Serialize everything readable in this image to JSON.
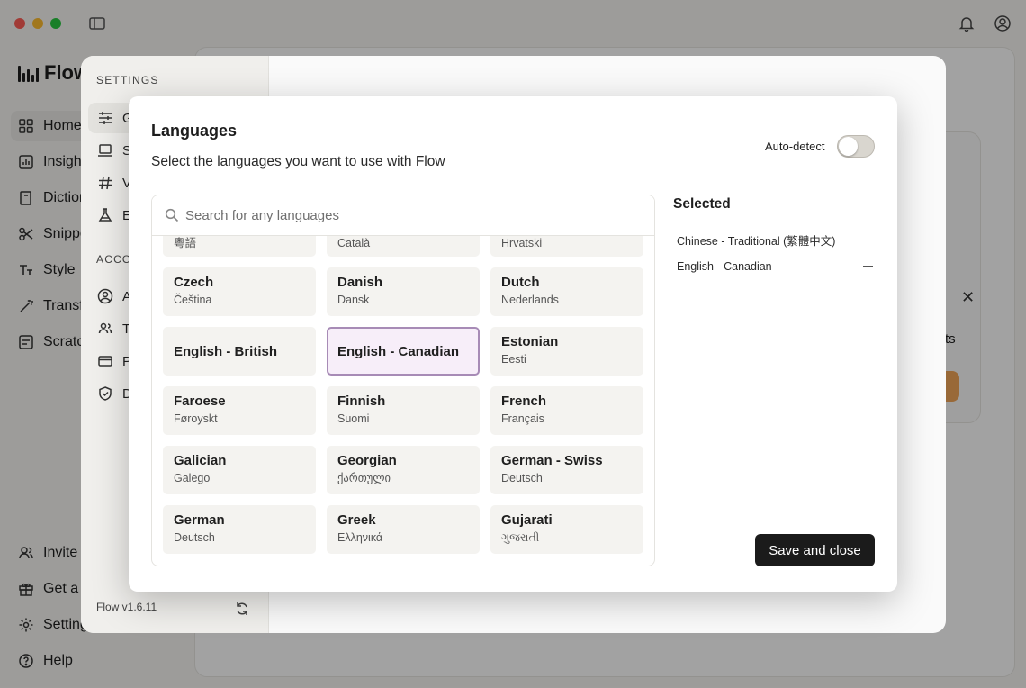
{
  "app": {
    "brand": "Flow"
  },
  "main_nav": [
    {
      "label": "Home",
      "icon": "grid-icon"
    },
    {
      "label": "Insights",
      "icon": "chart-icon"
    },
    {
      "label": "Dictionary",
      "icon": "book-icon"
    },
    {
      "label": "Snippets",
      "icon": "scissors-icon"
    },
    {
      "label": "Style",
      "icon": "text-style-icon"
    },
    {
      "label": "Transforms",
      "icon": "wand-icon"
    },
    {
      "label": "Scratchpad",
      "icon": "note-icon"
    }
  ],
  "main_nav_bottom": [
    {
      "label": "Invite",
      "icon": "people-icon"
    },
    {
      "label": "Get a",
      "icon": "gift-icon"
    },
    {
      "label": "Settings",
      "icon": "gear-icon"
    },
    {
      "label": "Help",
      "icon": "help-icon"
    }
  ],
  "settings": {
    "heading": "SETTINGS",
    "items": [
      {
        "label": "G"
      },
      {
        "label": "S"
      },
      {
        "label": "V"
      },
      {
        "label": "E"
      }
    ],
    "account_heading": "ACCO",
    "account_items": [
      {
        "label": "A"
      },
      {
        "label": "T"
      },
      {
        "label": "P"
      },
      {
        "label": "D"
      }
    ],
    "version": "Flow v1.6.11"
  },
  "background_text": "ts",
  "modal": {
    "title": "Languages",
    "subtitle": "Select the languages you want to use with Flow",
    "auto_detect_label": "Auto-detect",
    "auto_detect_on": false,
    "search_placeholder": "Search for any languages",
    "partial_row": [
      {
        "name": "",
        "native": "粵語"
      },
      {
        "name": "",
        "native": "Català"
      },
      {
        "name": "",
        "native": "Hrvatski"
      }
    ],
    "languages": [
      {
        "name": "Czech",
        "native": "Čeština"
      },
      {
        "name": "Danish",
        "native": "Dansk"
      },
      {
        "name": "Dutch",
        "native": "Nederlands"
      },
      {
        "name": "English - British",
        "native": ""
      },
      {
        "name": "English - Canadian",
        "native": "",
        "selected": true
      },
      {
        "name": "Estonian",
        "native": "Eesti"
      },
      {
        "name": "Faroese",
        "native": "Føroyskt"
      },
      {
        "name": "Finnish",
        "native": "Suomi"
      },
      {
        "name": "French",
        "native": "Français"
      },
      {
        "name": "Galician",
        "native": "Galego"
      },
      {
        "name": "Georgian",
        "native": "ქართული"
      },
      {
        "name": "German - Swiss",
        "native": "Deutsch"
      },
      {
        "name": "German",
        "native": "Deutsch"
      },
      {
        "name": "Greek",
        "native": "Ελληνικά"
      },
      {
        "name": "Gujarati",
        "native": "ગુજરાતી"
      }
    ],
    "selected_title": "Selected",
    "selected": [
      {
        "label": "Chinese - Traditional (繁體中文)"
      },
      {
        "label": "English - Canadian"
      }
    ],
    "save_label": "Save and close"
  },
  "colors": {
    "selected_card_border": "#a78bb6",
    "selected_card_bg": "#f7eef9",
    "save_button_bg": "#1b1b1b",
    "accent_button": "#f2a65a"
  }
}
